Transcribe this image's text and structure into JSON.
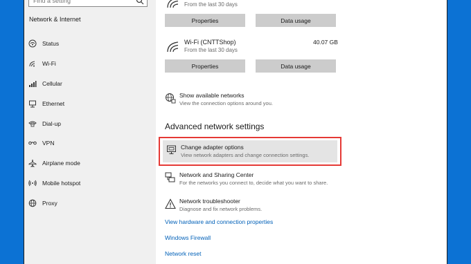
{
  "sidebar": {
    "search_placeholder": "Find a setting",
    "section_title": "Network & Internet",
    "items": [
      {
        "label": "Status",
        "icon": "status-icon"
      },
      {
        "label": "Wi-Fi",
        "icon": "wifi-icon"
      },
      {
        "label": "Cellular",
        "icon": "cellular-icon"
      },
      {
        "label": "Ethernet",
        "icon": "ethernet-icon"
      },
      {
        "label": "Dial-up",
        "icon": "dial-up-icon"
      },
      {
        "label": "VPN",
        "icon": "vpn-icon"
      },
      {
        "label": "Airplane mode",
        "icon": "airplane-icon"
      },
      {
        "label": "Mobile hotspot",
        "icon": "hotspot-icon"
      },
      {
        "label": "Proxy",
        "icon": "globe-icon"
      }
    ]
  },
  "networks": [
    {
      "name": "",
      "period": "From the last 30 days",
      "usage": "",
      "properties_label": "Properties",
      "data_usage_label": "Data usage"
    },
    {
      "name": "Wi-Fi (CNTTShop)",
      "period": "From the last 30 days",
      "usage": "40.07 GB",
      "properties_label": "Properties",
      "data_usage_label": "Data usage"
    }
  ],
  "show_networks": {
    "title": "Show available networks",
    "subtitle": "View the connection options around you."
  },
  "advanced_heading": "Advanced network settings",
  "adapter": {
    "title": "Change adapter options",
    "subtitle": "View network adapters and change connection settings."
  },
  "sharing": {
    "title": "Network and Sharing Center",
    "subtitle": "For the networks you connect to, decide what you want to share."
  },
  "troubleshooter": {
    "title": "Network troubleshooter",
    "subtitle": "Diagnose and fix network problems."
  },
  "links": {
    "hardware": "View hardware and connection properties",
    "firewall": "Windows Firewall",
    "reset": "Network reset"
  },
  "colors": {
    "frame_blue": "#0c72d4",
    "link_blue": "#0060b8",
    "highlight_red": "#e53935",
    "button_gray": "#cccccc"
  }
}
